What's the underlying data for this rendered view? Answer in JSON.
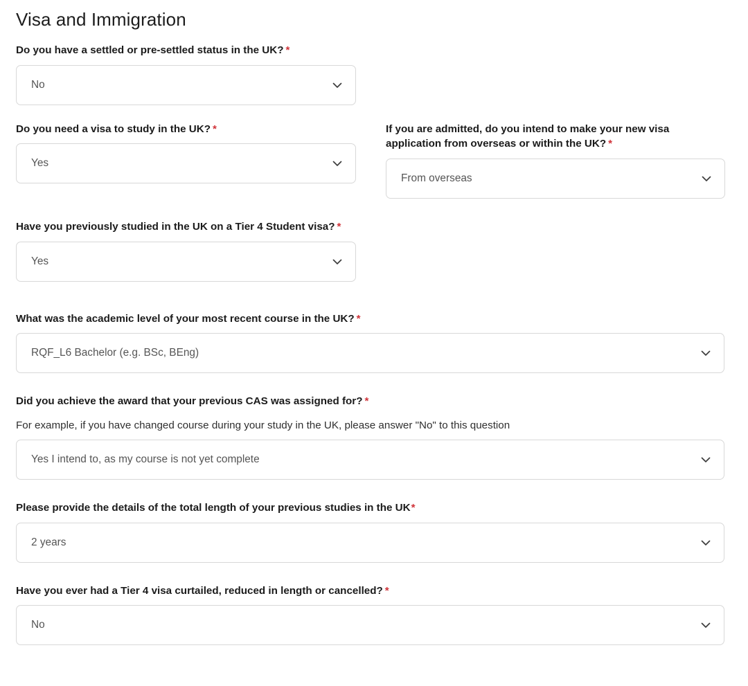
{
  "page": {
    "title": "Visa and Immigration",
    "required_marker": "*"
  },
  "fields": [
    {
      "id": "settled-status",
      "label": "Do you have a settled or pre-settled status in the UK?",
      "value": "No",
      "icon": "chevron-down-icon"
    },
    {
      "id": "need-visa",
      "label": "Do you need a visa to study in the UK?",
      "value": "Yes",
      "icon": "chevron-down-icon"
    },
    {
      "id": "visa-application-location",
      "label": "If you are admitted, do you intend to make your new visa application from overseas or within the UK?",
      "value": "From overseas",
      "icon": "chevron-down-icon"
    },
    {
      "id": "previous-tier4-study",
      "label": "Have you previously studied in the UK on a Tier 4 Student visa?",
      "value": "Yes",
      "icon": "chevron-down-icon"
    },
    {
      "id": "academic-level",
      "label": "What was the academic level of your most recent course in the UK?",
      "value": "RQF_L6 Bachelor (e.g. BSc, BEng)",
      "icon": "chevron-down-icon"
    },
    {
      "id": "cas-award-achieved",
      "label": "Did you achieve the award that your previous CAS was assigned for?",
      "helper": "For example, if you have changed course during your study in the UK, please answer \"No\" to this question",
      "value": "Yes I intend to, as my course is not yet complete",
      "icon": "chevron-down-icon"
    },
    {
      "id": "previous-study-length",
      "label": "Please provide the details of the total length of your previous studies in the UK",
      "value": "2 years",
      "icon": "chevron-down-icon"
    },
    {
      "id": "visa-curtailed",
      "label": "Have you ever had a Tier 4 visa curtailed, reduced in length or cancelled?",
      "value": "No",
      "icon": "chevron-down-icon"
    }
  ],
  "colors": {
    "required_asterisk": "#d0343a",
    "label_text": "#1b1b1b",
    "value_text": "#555555",
    "border": "#d8d8d8",
    "background": "#ffffff"
  }
}
